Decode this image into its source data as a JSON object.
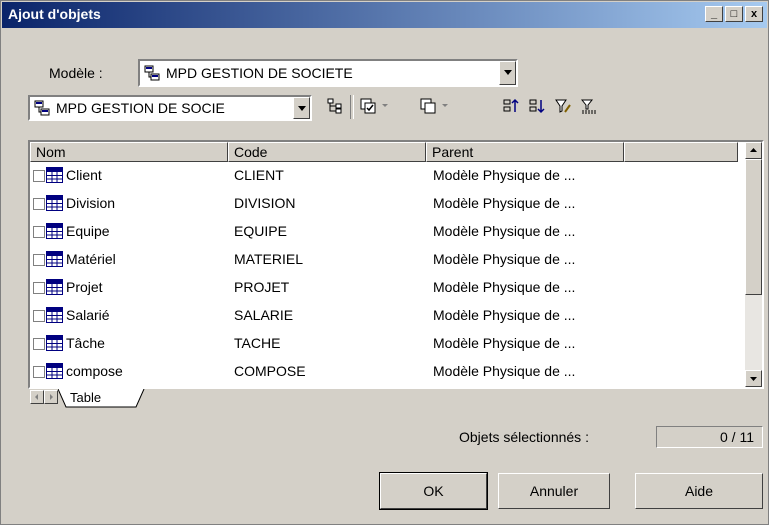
{
  "window": {
    "title": "Ajout d'objets",
    "controls": [
      "_",
      "□",
      "x"
    ]
  },
  "model": {
    "label": "Modèle :",
    "value": "MPD GESTION DE SOCIETE"
  },
  "toolbar": {
    "package_value": "MPD GESTION DE SOCIE",
    "icons": [
      "hierarchy-icon",
      "select-all-icon",
      "deselect-all-icon",
      "sort-ascending-icon",
      "sort-descending-icon",
      "filter-edit-icon",
      "filter-icon"
    ]
  },
  "grid": {
    "columns": [
      "Nom",
      "Code",
      "Parent",
      ""
    ],
    "rows": [
      {
        "name": "Client",
        "code": "CLIENT",
        "parent": "Modèle Physique de ..."
      },
      {
        "name": "Division",
        "code": "DIVISION",
        "parent": "Modèle Physique de ..."
      },
      {
        "name": "Equipe",
        "code": "EQUIPE",
        "parent": "Modèle Physique de ..."
      },
      {
        "name": "Matériel",
        "code": "MATERIEL",
        "parent": "Modèle Physique de ..."
      },
      {
        "name": "Projet",
        "code": "PROJET",
        "parent": "Modèle Physique de ..."
      },
      {
        "name": "Salarié",
        "code": "SALARIE",
        "parent": "Modèle Physique de ..."
      },
      {
        "name": "Tâche",
        "code": "TACHE",
        "parent": "Modèle Physique de ..."
      },
      {
        "name": "compose",
        "code": "COMPOSE",
        "parent": "Modèle Physique de ..."
      }
    ]
  },
  "tabs": {
    "active": "Table"
  },
  "status": {
    "label": "Objets sélectionnés :",
    "value": "0 / 11"
  },
  "buttons": {
    "ok": "OK",
    "cancel": "Annuler",
    "help": "Aide"
  },
  "colors": {
    "titlebar_start": "#0a246a",
    "titlebar_end": "#a6caf0",
    "face": "#d4d0c8"
  }
}
